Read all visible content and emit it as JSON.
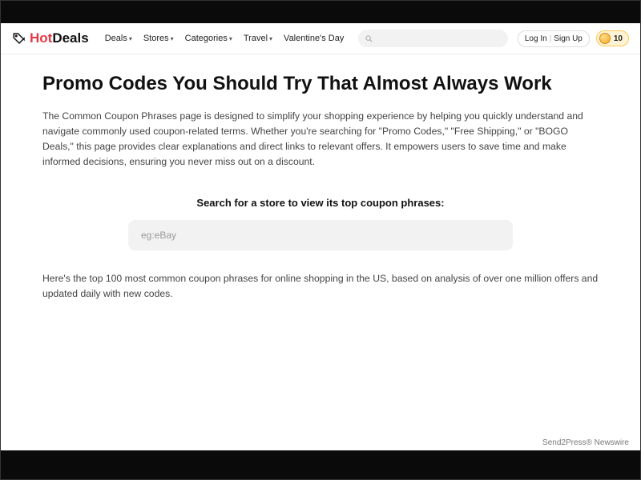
{
  "logo": {
    "hot": "Hot",
    "deals": "Deals"
  },
  "nav": {
    "deals": "Deals",
    "stores": "Stores",
    "categories": "Categories",
    "travel": "Travel",
    "valentines": "Valentine's Day"
  },
  "auth": {
    "login": "Log In",
    "signup": "Sign Up"
  },
  "coins": "10",
  "page": {
    "title": "Promo Codes You Should Try That Almost Always Work",
    "intro": "The Common Coupon Phrases page is designed to simplify your shopping experience by helping you quickly understand and navigate commonly used coupon-related terms. Whether you're searching for \"Promo Codes,\" \"Free Shipping,\" or \"BOGO Deals,\" this page provides clear explanations and direct links to relevant offers. It empowers users to save time and make informed decisions, ensuring you never miss out on a discount.",
    "search_label": "Search for a store to view its top coupon phrases:",
    "search_placeholder": "eg:eBay",
    "subtext": "Here's the top 100 most common coupon phrases for online shopping in the US, based on analysis of over one million offers and updated daily with new codes."
  },
  "footer": {
    "credit": "Send2Press® Newswire"
  }
}
